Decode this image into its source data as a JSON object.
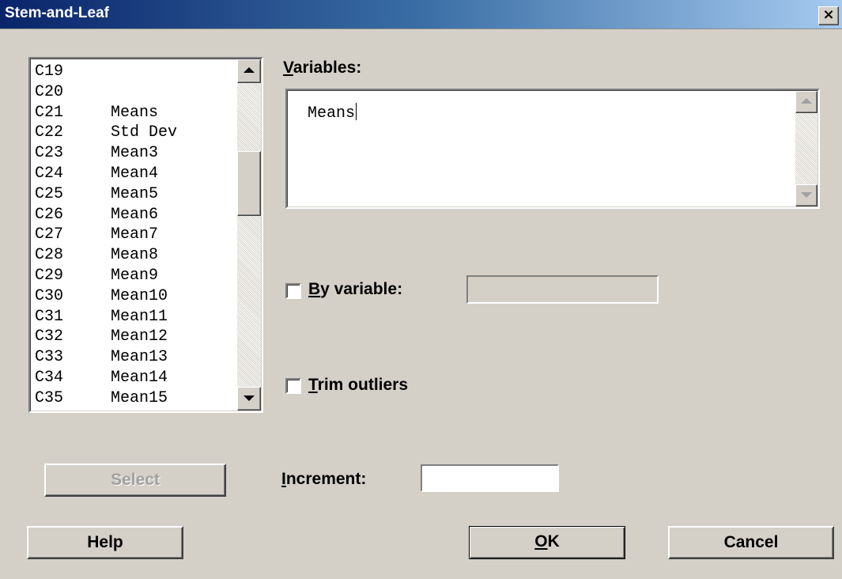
{
  "window": {
    "title": "Stem-and-Leaf",
    "close_glyph": "×"
  },
  "column_list": {
    "items": [
      {
        "id": "C19",
        "name": ""
      },
      {
        "id": "C20",
        "name": ""
      },
      {
        "id": "C21",
        "name": "Means"
      },
      {
        "id": "C22",
        "name": "Std Dev"
      },
      {
        "id": "C23",
        "name": "Mean3"
      },
      {
        "id": "C24",
        "name": "Mean4"
      },
      {
        "id": "C25",
        "name": "Mean5"
      },
      {
        "id": "C26",
        "name": "Mean6"
      },
      {
        "id": "C27",
        "name": "Mean7"
      },
      {
        "id": "C28",
        "name": "Mean8"
      },
      {
        "id": "C29",
        "name": "Mean9"
      },
      {
        "id": "C30",
        "name": "Mean10"
      },
      {
        "id": "C31",
        "name": "Mean11"
      },
      {
        "id": "C32",
        "name": "Mean12"
      },
      {
        "id": "C33",
        "name": "Mean13"
      },
      {
        "id": "C34",
        "name": "Mean14"
      },
      {
        "id": "C35",
        "name": "Mean15"
      }
    ]
  },
  "variables": {
    "label_key": "V",
    "label_rest": "ariables:",
    "value": "Means"
  },
  "by_variable": {
    "label_key": "B",
    "label_rest": "y variable:",
    "checked": false,
    "value": ""
  },
  "trim_outliers": {
    "label_key": "T",
    "label_rest": "rim outliers",
    "checked": false
  },
  "increment": {
    "label_key": "I",
    "label_rest": "ncrement:",
    "value": ""
  },
  "buttons": {
    "select": "Select",
    "help": "Help",
    "ok_key": "O",
    "ok_rest": "K",
    "cancel": "Cancel"
  }
}
